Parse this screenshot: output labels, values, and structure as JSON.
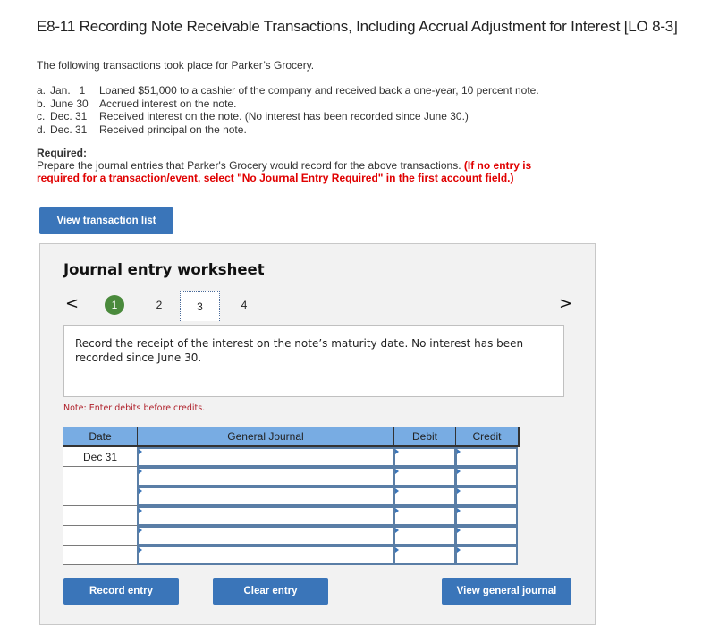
{
  "title": "E8-11 Recording Note Receivable Transactions, Including Accrual Adjustment for Interest [LO 8-3]",
  "intro": "The following transactions took place for Parker’s Grocery.",
  "transactions": [
    {
      "letter": "a.",
      "date": "Jan.   1",
      "desc": "Loaned $51,000 to a cashier of the company and received back a one-year, 10 percent note."
    },
    {
      "letter": "b.",
      "date": "June 30",
      "desc": "Accrued interest on the note."
    },
    {
      "letter": "c.",
      "date": "Dec. 31",
      "desc": "Received interest on the note. (No interest has been recorded since June 30.)"
    },
    {
      "letter": "d.",
      "date": "Dec. 31",
      "desc": "Received principal on the note."
    }
  ],
  "required": {
    "label": "Required:",
    "text": "Prepare the journal entries that Parker's Grocery would record for the above transactions. ",
    "instruction": "(If no entry is required for a transaction/event, select \"No Journal Entry Required\" in the first account field.)"
  },
  "buttons": {
    "view_transaction_list": "View transaction list",
    "record_entry": "Record entry",
    "clear_entry": "Clear entry",
    "view_general_journal": "View general journal"
  },
  "worksheet": {
    "title": "Journal entry worksheet",
    "nav_prev": "<",
    "nav_next": ">",
    "steps": [
      "1",
      "2",
      "3",
      "4"
    ],
    "completed_step": "1",
    "current_step": "3",
    "prompt": "Record the receipt of the interest on the note’s maturity date. No interest has been recorded since June 30.",
    "note": "Note: Enter debits before credits."
  },
  "journal": {
    "headers": {
      "date": "Date",
      "general_journal": "General Journal",
      "debit": "Debit",
      "credit": "Credit"
    },
    "rows": [
      {
        "date": "Dec 31",
        "account": "",
        "debit": "",
        "credit": ""
      },
      {
        "date": "",
        "account": "",
        "debit": "",
        "credit": ""
      },
      {
        "date": "",
        "account": "",
        "debit": "",
        "credit": ""
      },
      {
        "date": "",
        "account": "",
        "debit": "",
        "credit": ""
      },
      {
        "date": "",
        "account": "",
        "debit": "",
        "credit": ""
      },
      {
        "date": "",
        "account": "",
        "debit": "",
        "credit": ""
      }
    ]
  },
  "colors": {
    "button_blue": "#3a75b9",
    "header_blue": "#78ace3",
    "completed_green": "#4a8a3c",
    "warning_red": "#e00000",
    "note_red": "#b0222c"
  }
}
